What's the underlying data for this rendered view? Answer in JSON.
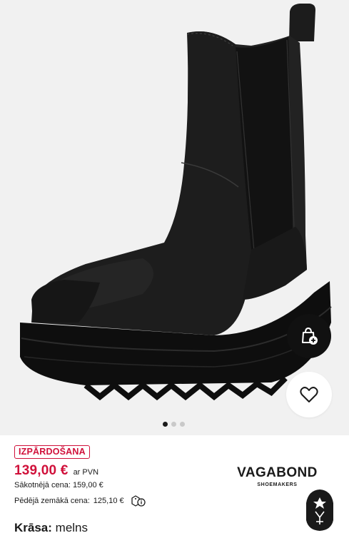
{
  "gallery": {
    "image_alt": "black leather chelsea boot with platform sole",
    "dots_total": 3,
    "active_dot": 0,
    "cart_icon": "bag-plus-icon",
    "wishlist_icon": "heart-icon"
  },
  "product": {
    "badge": "IZPĀRDOŠANA",
    "price": "139,00 €",
    "vat_note": "ar PVN",
    "original_price": "Sākotnējā cena: 159,00 €",
    "lowest_label": "Pēdējā zemākā cena:",
    "lowest_value": "125,10 €",
    "lowest_info_icon": "price-tag-info-icon",
    "color_label": "Krāsa:",
    "color_value": "melns"
  },
  "brand": {
    "name": "VAGABOND",
    "subtitle": "SHOEMAKERS"
  },
  "colors": {
    "sale": "#d0103a",
    "gallery_bg": "#f1f1f1",
    "button_dark": "#111111"
  }
}
